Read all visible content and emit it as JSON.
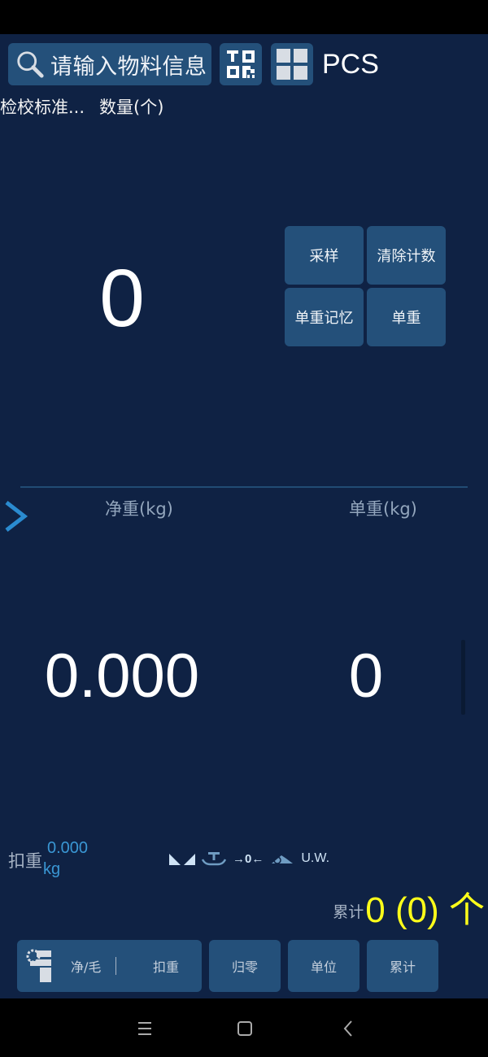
{
  "header": {
    "search_placeholder": "请输入物料信息",
    "unit": "PCS"
  },
  "sub_labels": {
    "standard": "检校标准...",
    "quantity": "数量(个)"
  },
  "count": {
    "value": "0"
  },
  "function_buttons": [
    {
      "label": "采样"
    },
    {
      "label": "清除计数"
    },
    {
      "label": "单重记忆"
    },
    {
      "label": "单重"
    }
  ],
  "readouts": {
    "net_label": "净重(kg)",
    "unit_weight_label": "单重(kg)",
    "net_value": "0.000",
    "unit_weight_value": "0"
  },
  "tare": {
    "label": "扣重",
    "value": "0.000",
    "unit": "kg"
  },
  "indicators": {
    "zero_text": "→0←",
    "uw_text": "U.W."
  },
  "total": {
    "label": "累计",
    "value": "0 (0) 个"
  },
  "bottom_bar": {
    "net_gross": "净/毛",
    "tare": "扣重",
    "zero": "归零",
    "unit": "单位",
    "total": "累计"
  },
  "colors": {
    "background": "#0f2244",
    "button": "#24507a",
    "accent_blue": "#3a97d4",
    "total_yellow": "#ffff1a"
  }
}
